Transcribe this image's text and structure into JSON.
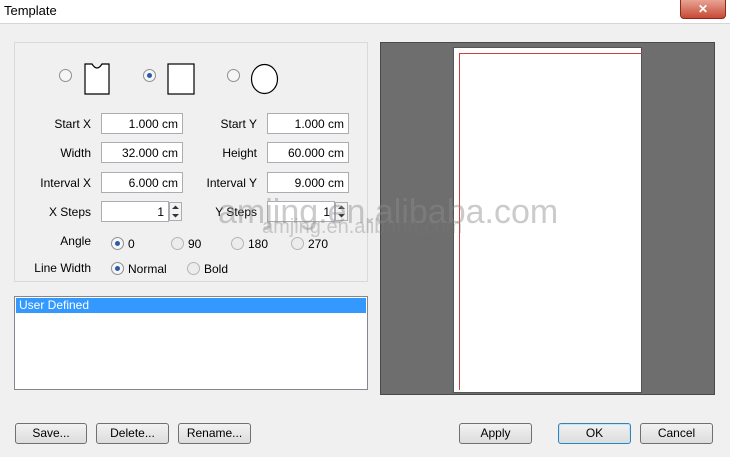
{
  "window": {
    "title": "Template",
    "close_glyph": "✕"
  },
  "shapes": [
    {
      "name": "notched-rectangle",
      "selected": false
    },
    {
      "name": "rectangle",
      "selected": true
    },
    {
      "name": "circle",
      "selected": false
    }
  ],
  "fields": {
    "start_x": {
      "label": "Start X",
      "value": "1.000 cm"
    },
    "start_y": {
      "label": "Start Y",
      "value": "1.000 cm"
    },
    "width": {
      "label": "Width",
      "value": "32.000 cm"
    },
    "height": {
      "label": "Height",
      "value": "60.000 cm"
    },
    "interval_x": {
      "label": "Interval X",
      "value": "6.000 cm"
    },
    "interval_y": {
      "label": "Interval Y",
      "value": "9.000 cm"
    },
    "x_steps": {
      "label": "X Steps",
      "value": "1"
    },
    "y_steps": {
      "label": "Y Steps",
      "value": "1"
    }
  },
  "angle": {
    "label": "Angle",
    "options": [
      "0",
      "90",
      "180",
      "270"
    ],
    "selected": "0"
  },
  "line_width": {
    "label": "Line Width",
    "options": [
      "Normal",
      "Bold"
    ],
    "selected": "Normal"
  },
  "template_list": {
    "items": [
      "User Defined"
    ],
    "selected": "User Defined"
  },
  "buttons": {
    "save": "Save...",
    "delete": "Delete...",
    "rename": "Rename...",
    "apply": "Apply",
    "ok": "OK",
    "cancel": "Cancel"
  },
  "watermark": {
    "large": "amjing.en.alibaba.com",
    "small": "amjing.en.alibaba.com"
  },
  "colors": {
    "list_selection": "#3399ff",
    "preview_background": "#6e6e6e",
    "template_outline": "#d63a3a"
  }
}
